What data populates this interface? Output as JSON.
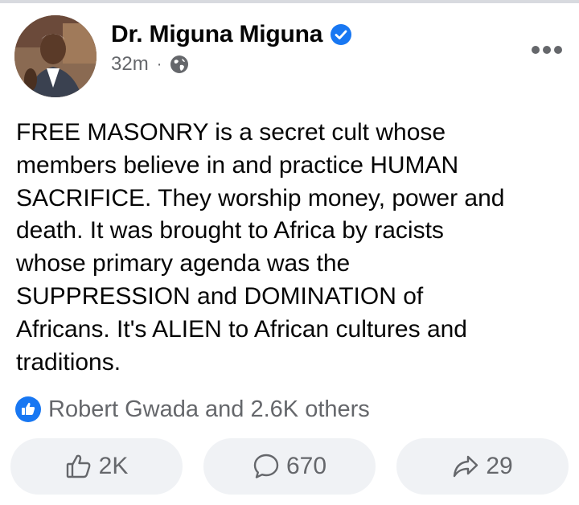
{
  "post": {
    "author": "Dr. Miguna Miguna",
    "time": "32m",
    "separator": "·",
    "text": "FREE MASONRY is a secret cult whose\nmembers believe in and practice HUMAN\nSACRIFICE. They worship money, power and\ndeath. It was brought to Africa by racists\nwhose primary agenda was the\nSUPPRESSION and DOMINATION of\nAfricans. It's ALIEN to African cultures and\ntraditions."
  },
  "reactions": {
    "summary": "Robert Gwada and 2.6K others"
  },
  "actions": {
    "like_count": "2K",
    "comment_count": "670",
    "share_count": "29"
  },
  "icons": {
    "verified": "verified-badge-icon",
    "audience": "globe-icon",
    "more": "more-options-icon",
    "reaction": "like-reaction-icon",
    "like": "thumbs-up-icon",
    "comment": "comment-bubble-icon",
    "share": "share-arrow-icon"
  },
  "colors": {
    "brand_blue": "#1877f2",
    "secondary_text": "#65676b",
    "button_bg": "#f0f2f5"
  }
}
